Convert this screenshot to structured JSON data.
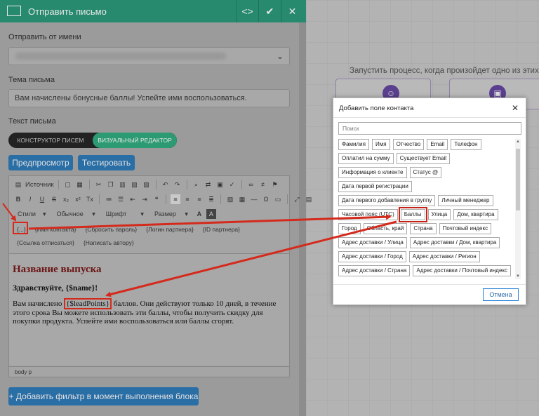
{
  "panel": {
    "title": "Отправить письмо",
    "header_buttons": [
      "<>",
      "✔",
      "✕"
    ],
    "from_label": "Отправить от имени",
    "subject_label": "Тема письма",
    "subject_value": "Вам начислены бонусные баллы! Успейте ими воспользоваться.",
    "text_label": "Текст письма",
    "mode_builder": "КОНСТРУКТОР ПИСЕМ",
    "mode_visual": "ВИЗУАЛЬНЫЙ РЕДАКТОР",
    "preview_btn": "Предпросмотр",
    "test_btn": "Тестировать",
    "add_filter_btn": "+ Добавить фильтр в момент выполнения блока"
  },
  "editor": {
    "source_label": "Источник",
    "styles": "Стили",
    "format": "Обычное",
    "font": "Шрифт",
    "size": "Размер",
    "placeholders": [
      "{...}",
      "{Имя контакта}",
      "{Сбросить пароль}",
      "{Логин партнера}",
      "{ID партнера}",
      "{Ссылка отписаться}",
      "{Написать автору}"
    ],
    "content_title": "Название выпуска",
    "content_greeting": "Здравствуйте, {$name}!",
    "content_body_pre": "Вам начислено ",
    "content_body_var": "{$leadPoints}",
    "content_body_post": " баллов. Они действуют только 10 дней, в течение этого срока Вы можете использовать эти баллы, чтобы получить скидку для покупки продукта. Успейте ими воспользоваться или баллы сгорят.",
    "footer_path": "body  p"
  },
  "canvas": {
    "text": "Запустить процесс, когда произойдет одно из этих дей"
  },
  "dialog": {
    "title": "Добавить поле контакта",
    "search_placeholder": "Поиск",
    "rows": [
      [
        "Фамилия",
        "Имя",
        "Отчество",
        "Email",
        "Телефон"
      ],
      [
        "Оплатил на сумму",
        "Существует Email"
      ],
      [
        "Информация о клиенте",
        "Статус @"
      ],
      [
        "Дата первой регистрации"
      ],
      [
        "Дата первого добавления в группу",
        "Личный менеджер"
      ],
      [
        "Часовой пояс (UTC)",
        "Баллы",
        "Улица",
        "Дом, квартира"
      ],
      [
        "Город",
        "Область, край",
        "Страна",
        "Почтовый индекс"
      ],
      [
        "Адрес доставки / Улица",
        "Адрес доставки / Дом, квартира"
      ],
      [
        "Адрес доставки / Город",
        "Адрес доставки / Регион"
      ],
      [
        "Адрес доставки / Страна",
        "Адрес доставки / Почтовый индекс"
      ]
    ],
    "cancel": "Отмена"
  },
  "colors": {
    "header_green": "#278a6e",
    "button_blue": "#2a6ea6",
    "annotation_red": "#d42a1c"
  }
}
